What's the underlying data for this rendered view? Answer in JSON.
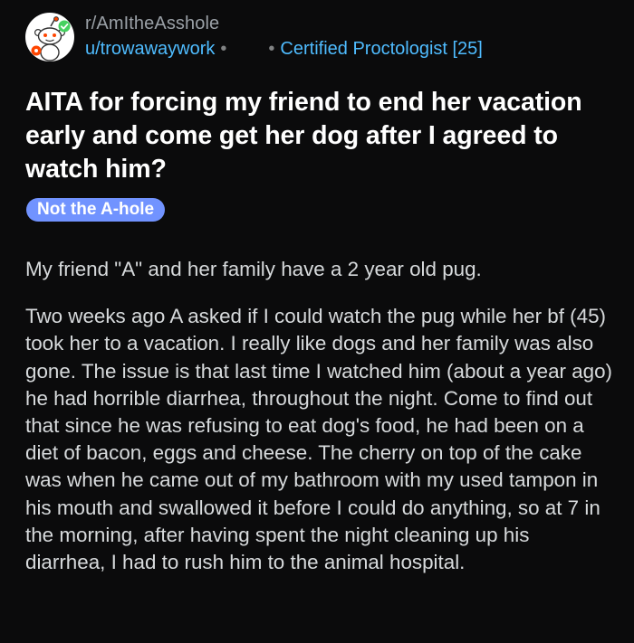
{
  "post": {
    "subreddit": "r/AmItheAsshole",
    "username": "u/trowawaywork",
    "separator": "•",
    "user_flair": "Certified Proctologist [25]",
    "title": "AITA for forcing my friend to end her vacation early and come get her dog after I agreed to watch him?",
    "post_flair": "Not the A-hole",
    "body": [
      "My friend \"A\" and her family have a 2 year old pug.",
      "Two weeks ago A asked if I could watch the pug while her bf (45) took her to a vacation. I really like dogs and her family was also gone. The issue is that last time I watched him (about a year ago) he had horrible diarrhea, throughout the night. Come to find out that since he was refusing to eat dog's food, he had been on a diet of bacon, eggs and cheese. The cherry on top of the cake was when he came out of my bathroom with my used tampon in his mouth and swallowed it before I could do anything, so at 7 in the morning, after having spent the night cleaning up his diarrhea, I had to rush him to the animal hospital."
    ]
  },
  "icons": {
    "avatar": "reddit-snoo-avatar-icon"
  },
  "colors": {
    "background": "#0b0b0c",
    "title": "#ffffff",
    "body_text": "#d7dadc",
    "muted": "#9aa0a6",
    "link_blue": "#4fbcff",
    "post_flair_bg": "#7193ff"
  }
}
